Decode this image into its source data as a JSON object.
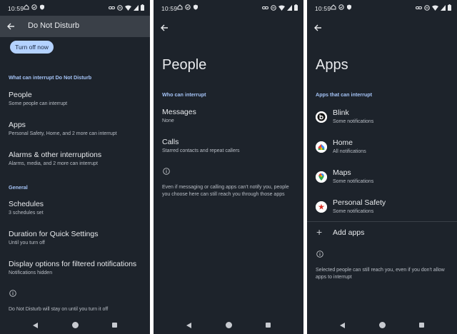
{
  "status": {
    "time": "10:59"
  },
  "dnd": {
    "title": "Do Not Disturb",
    "turn_off_label": "Turn off now",
    "section_interrupt": "What can interrupt Do Not Disturb",
    "items": [
      {
        "title": "People",
        "subtitle": "Some people can interrupt"
      },
      {
        "title": "Apps",
        "subtitle": "Personal Safety, Home, and 2 more can interrupt"
      },
      {
        "title": "Alarms & other interruptions",
        "subtitle": "Alarms, media, and 2 more can interrupt"
      }
    ],
    "section_general": "General",
    "general_items": [
      {
        "title": "Schedules",
        "subtitle": "3 schedules set"
      },
      {
        "title": "Duration for Quick Settings",
        "subtitle": "Until you turn off"
      },
      {
        "title": "Display options for filtered notifications",
        "subtitle": "Notifications hidden"
      }
    ],
    "footer": "Do Not Disturb will stay on until you turn it off"
  },
  "people": {
    "title": "People",
    "section": "Who can interrupt",
    "items": [
      {
        "title": "Messages",
        "subtitle": "None"
      },
      {
        "title": "Calls",
        "subtitle": "Starred contacts and repeat callers"
      }
    ],
    "footer_line1": "Even if messaging or calling apps can't notify you, people",
    "footer_line2": "you choose here can still reach you through those apps"
  },
  "apps": {
    "title": "Apps",
    "section": "Apps that can interrupt",
    "items": [
      {
        "name": "Blink",
        "subtitle": "Some notifications",
        "icon": "blink-icon"
      },
      {
        "name": "Home",
        "subtitle": "All notifications",
        "icon": "google-home-icon"
      },
      {
        "name": "Maps",
        "subtitle": "Some notifications",
        "icon": "google-maps-icon"
      },
      {
        "name": "Personal Safety",
        "subtitle": "Some notifications",
        "icon": "personal-safety-icon"
      }
    ],
    "add_label": "Add apps",
    "footer_line1": "Selected people can still reach you, even if you don't allow",
    "footer_line2": "apps to interrupt"
  },
  "colors": {
    "background": "#1d232b",
    "app_bar": "#3a4048",
    "accent_text": "#a4c3f6",
    "button_fill": "#b4d2ff"
  }
}
